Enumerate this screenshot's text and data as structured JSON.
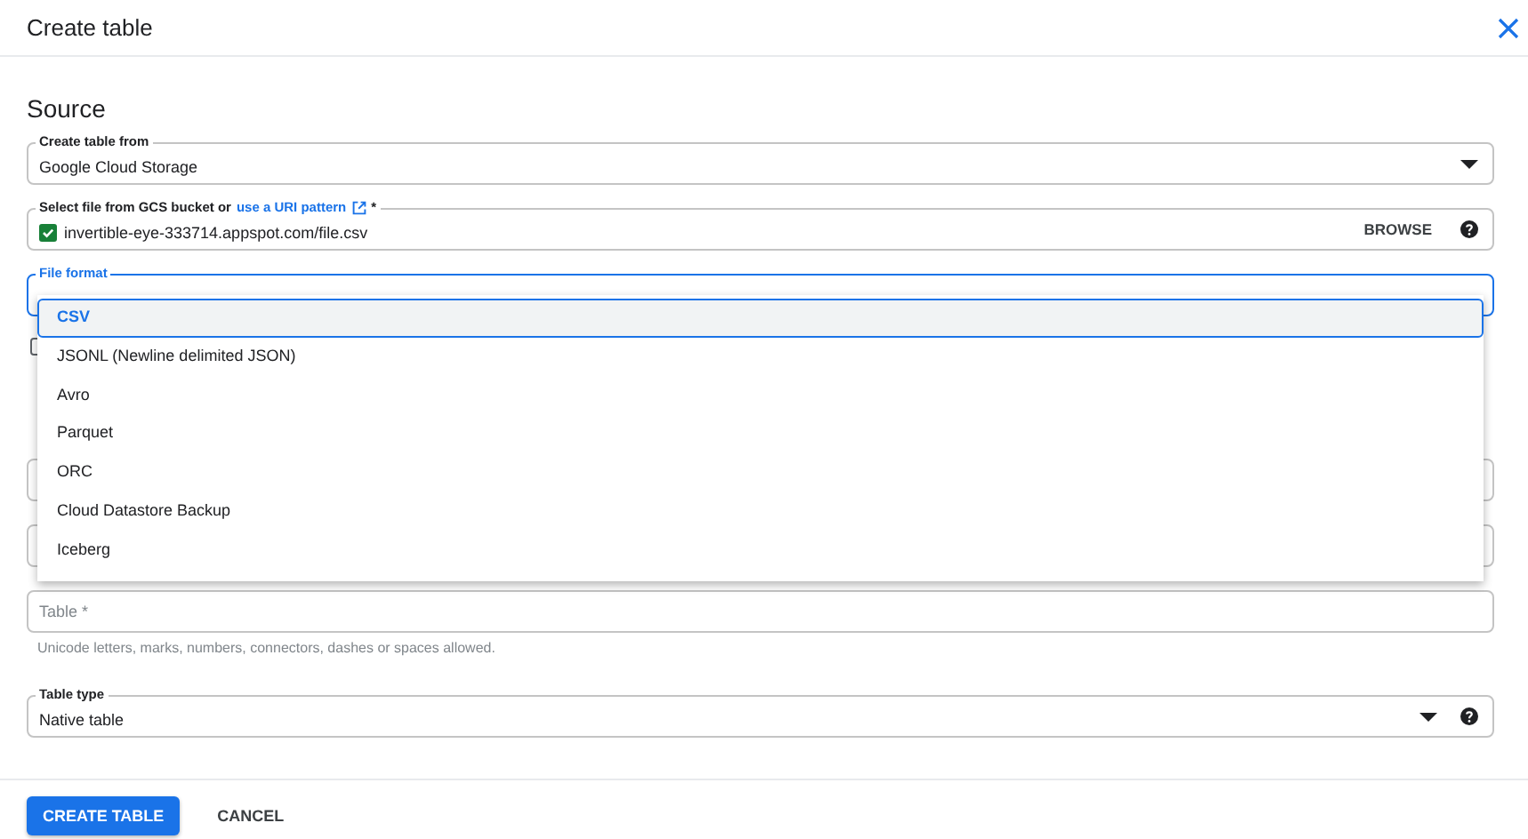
{
  "window": {
    "title": "Create table"
  },
  "source": {
    "heading": "Source",
    "create_from": {
      "label": "Create table from",
      "value": "Google Cloud Storage"
    },
    "file": {
      "label": "Select file from GCS bucket or",
      "link": "use a URI pattern",
      "required_mark": "*",
      "value": "invertible-eye-333714.appspot.com/file.csv",
      "valid": true,
      "browse": "BROWSE"
    },
    "file_format": {
      "label": "File format",
      "focused": true,
      "options": [
        {
          "label": "CSV",
          "selected": true
        },
        {
          "label": "JSONL (Newline delimited JSON)",
          "selected": false
        },
        {
          "label": "Avro",
          "selected": false
        },
        {
          "label": "Parquet",
          "selected": false
        },
        {
          "label": "ORC",
          "selected": false
        },
        {
          "label": "Cloud Datastore Backup",
          "selected": false
        },
        {
          "label": "Iceberg",
          "selected": false
        }
      ]
    },
    "checkbox": {
      "checked": false
    }
  },
  "destination": {
    "table": {
      "placeholder": "Table *",
      "hint": "Unicode letters, marks, numbers, connectors, dashes or spaces allowed."
    },
    "table_type": {
      "label": "Table type",
      "value": "Native table"
    }
  },
  "buttons": [
    {
      "label": "CREATE TABLE",
      "kind": "primary"
    },
    {
      "label": "CANCEL",
      "kind": "text"
    }
  ]
}
